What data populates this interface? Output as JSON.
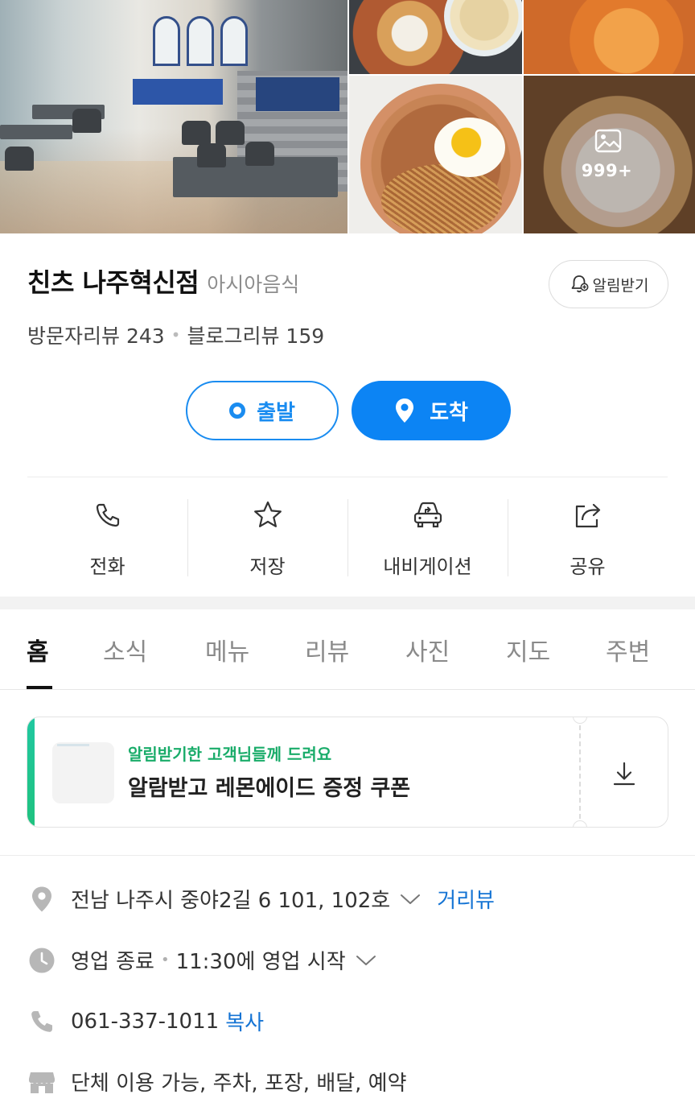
{
  "gallery": {
    "more_count": "999+",
    "more_icon": "image-icon"
  },
  "place": {
    "name": "친츠 나주혁신점",
    "category": "아시아음식",
    "notify_label": "알림받기",
    "visitor_reviews_label": "방문자리뷰 243",
    "blog_reviews_label": "블로그리뷰 159"
  },
  "route": {
    "start_label": "출발",
    "arrive_label": "도착"
  },
  "actions": [
    {
      "label": "전화",
      "icon": "phone-icon"
    },
    {
      "label": "저장",
      "icon": "star-icon"
    },
    {
      "label": "내비게이션",
      "icon": "car-navigation-icon"
    },
    {
      "label": "공유",
      "icon": "share-icon"
    }
  ],
  "tabs": [
    "홈",
    "소식",
    "메뉴",
    "리뷰",
    "사진",
    "지도",
    "주변"
  ],
  "active_tab": "홈",
  "coupon": {
    "subtitle": "알림받기한 고객님들께 드려요",
    "title": "알람받고 레몬에이드 증정 쿠폰",
    "download_icon": "download-icon"
  },
  "info": {
    "address": "전남 나주시 중야2길 6 101, 102호",
    "street_view_label": "거리뷰",
    "hours_status": "영업 종료",
    "hours_next": "11:30에 영업 시작",
    "phone": "061-337-1011",
    "copy_label": "복사",
    "facilities": "단체 이용 가능, 주차, 포장, 배달, 예약"
  },
  "colors": {
    "accent_blue": "#0c84f4",
    "coupon_green": "#1aac6a",
    "link_blue": "#1574d4"
  }
}
